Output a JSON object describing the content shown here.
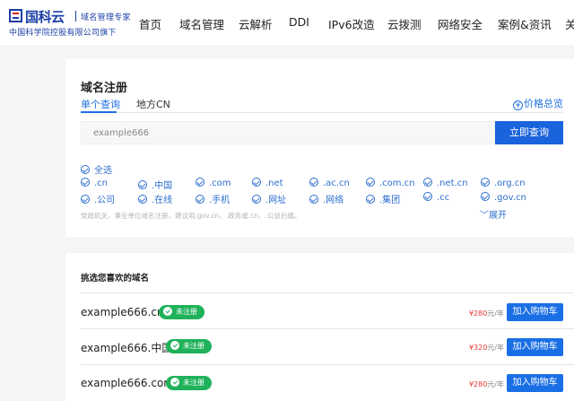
{
  "header": {
    "logo_name": "国科云",
    "logo_tag": "域名管理专家",
    "logo_sub": "中国科学院控股有限公司旗下",
    "nav": [
      "首页",
      "域名管理",
      "云解析",
      "DDI",
      "IPv6改造",
      "云拨测",
      "网络安全",
      "案例&资讯",
      "关"
    ]
  },
  "search": {
    "title": "域名注册",
    "tab_active": "单个查询",
    "tab_other": "地方CN",
    "price_link": "价格总览",
    "input_value": "example666",
    "button": "立即查询",
    "select_all": "全选",
    "suffixes_row1": [
      ".cn",
      ".中国",
      ".com",
      ".net",
      ".ac.cn",
      ".com.cn",
      ".net.cn",
      ".org.cn"
    ],
    "suffixes_row2": [
      ".公司",
      ".在线",
      ".手机",
      ".网址",
      ".网络",
      ".集团",
      ".cc",
      ".gov.cn"
    ],
    "hint": "党政机关、事业单位域名注册，建议用.gov.cn、.政务或.cn、.公益后缀。",
    "expand": "展开"
  },
  "results": {
    "title": "挑选您喜欢的域名",
    "cart_label": "加入购物车",
    "status_label": "未注册",
    "price_unit": "元/年",
    "rows": [
      {
        "domain": "example666.cn",
        "price": "¥280",
        "unit": "元/年"
      },
      {
        "domain": "example666.中国",
        "price": "¥320",
        "unit": "元/年"
      },
      {
        "domain": "example666.com",
        "price": "¥280",
        "unit": "元/年"
      }
    ]
  },
  "colors": {
    "brand": "#1b3fa6",
    "primary": "#1a63dc",
    "success": "#1fb25a",
    "price": "#e53935"
  }
}
